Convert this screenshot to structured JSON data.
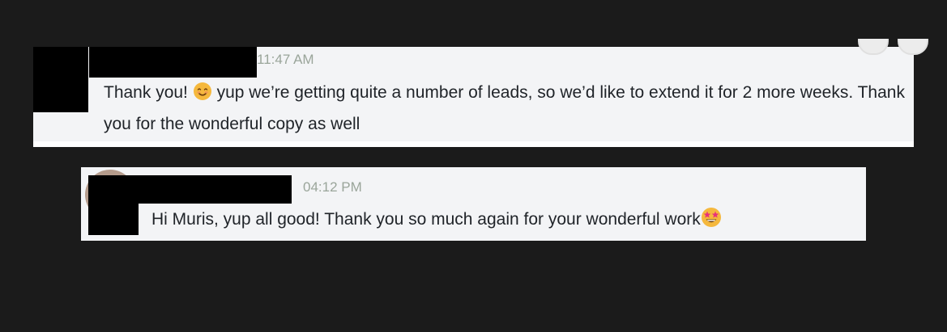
{
  "messages": [
    {
      "time": "11:47 AM",
      "text_before_emoji": "Thank you! ",
      "emoji": "smiling-face-emoji",
      "text_after_emoji": " yup we’re getting quite a number of leads, so we’d like to extend it for 2 more weeks. Thank you for the wonderful copy as well"
    },
    {
      "time": "04:12 PM",
      "text": "Hi Muris, yup all good! Thank you so much again for your wonderful work",
      "emoji": "star-struck-emoji"
    }
  ],
  "colors": {
    "background": "#1b1b1b",
    "card": "#f3f4f6",
    "timestamp": "#9aa59a",
    "text": "#1f2328",
    "redaction": "#000000"
  }
}
